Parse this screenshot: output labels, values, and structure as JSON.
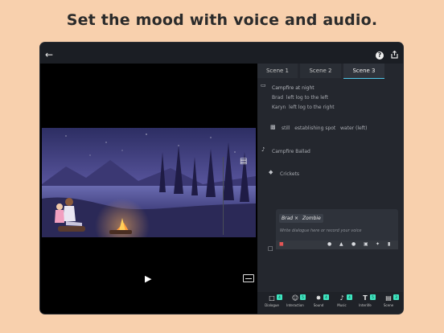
{
  "headline": "Set the mood with voice and audio.",
  "topbar": {
    "back_icon": "arrow-left-icon",
    "help_icon": "help-icon",
    "share_icon": "share-icon"
  },
  "tabs": [
    {
      "label": "Scene 1"
    },
    {
      "label": "Scene 2"
    },
    {
      "label": "Scene 3",
      "active": true
    }
  ],
  "scene": {
    "title": "Campfire at night",
    "characters": [
      {
        "name": "Brad",
        "position": "left log to the left"
      },
      {
        "name": "Karyn",
        "position": "left log to the right"
      }
    ],
    "camera": {
      "parts": [
        "still",
        "establishing spot",
        "water (left)"
      ]
    },
    "music": "Campfire Ballad",
    "sound": "Crickets"
  },
  "dialogue": {
    "speaker": "Brad",
    "remove_symbol": "×",
    "voice": "Zombie",
    "placeholder": "Write dialogue here or record your voice"
  },
  "bottom": [
    {
      "label": "Dialogue",
      "icon": "dialogue-icon",
      "count": "4"
    },
    {
      "label": "Interaction",
      "icon": "interaction-icon",
      "count": "5"
    },
    {
      "label": "Sound",
      "icon": "sound-icon",
      "count": "4"
    },
    {
      "label": "Music",
      "icon": "music-icon",
      "count": "4"
    },
    {
      "label": "Interlife",
      "icon": "text-icon",
      "count": "5"
    },
    {
      "label": "Scene",
      "icon": "scene-icon",
      "count": "3"
    }
  ],
  "colors": {
    "accent": "#4ec6e8",
    "badge": "#3ee6c0",
    "background": "#f8d0ad"
  }
}
